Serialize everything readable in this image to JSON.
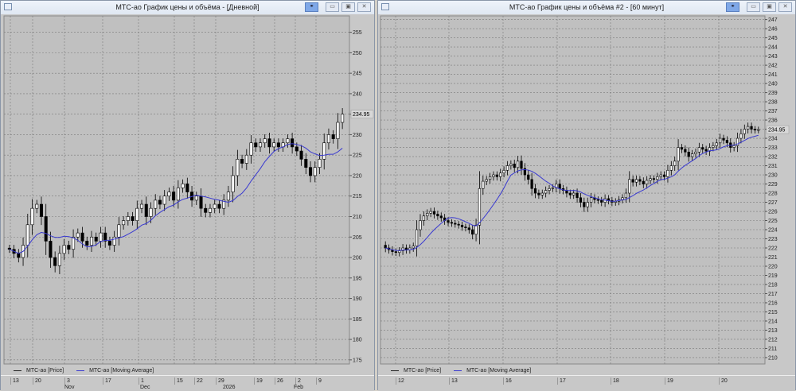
{
  "windows": [
    {
      "id": "left",
      "title": "МТС-ао График цены и объёма - [Дневной]",
      "legend": [
        "МТС-ао [Price]",
        "МТС-ао [Moving Average]"
      ],
      "last_price": "234.95",
      "y_ticks": [
        255,
        250,
        245,
        240,
        235,
        230,
        225,
        220,
        215,
        210,
        205,
        200,
        195,
        190,
        185,
        180,
        175
      ],
      "y_range": [
        174,
        259
      ],
      "date_ticks": [
        "13",
        "20",
        "3",
        "17",
        "1",
        "15",
        "22",
        "29",
        "19",
        "26",
        "2",
        "9"
      ],
      "month_labels": [
        "Nov",
        "Dec",
        "2026",
        "Feb"
      ],
      "closes": [
        202,
        201,
        200,
        203,
        208,
        212,
        213,
        210,
        204,
        200,
        198,
        201,
        203,
        202,
        205,
        206,
        204,
        203,
        205,
        204,
        206,
        204,
        203,
        205,
        208,
        209,
        210,
        209,
        212,
        213,
        210,
        212,
        214,
        213,
        215,
        216,
        214,
        217,
        218,
        216,
        214,
        215,
        212,
        211,
        212,
        213,
        212,
        214,
        216,
        220,
        224,
        223,
        225,
        228,
        227,
        228,
        229,
        227,
        228,
        227,
        228,
        229,
        227,
        226,
        224,
        222,
        220,
        222,
        224,
        228,
        230,
        229,
        233,
        235
      ]
    },
    {
      "id": "right",
      "title": "МТС-ао График цены и объёма #2 - [60 минут]",
      "legend": [
        "МТС-ао [Price]",
        "МТС-ао [Moving Average]"
      ],
      "last_price": "234.95",
      "y_ticks": [
        247,
        246,
        245,
        244,
        243,
        242,
        241,
        240,
        239,
        238,
        237,
        236,
        235,
        234,
        233,
        232,
        231,
        230,
        229,
        228,
        227,
        226,
        225,
        224,
        223,
        222,
        221,
        220,
        219,
        218,
        217,
        216,
        215,
        214,
        213,
        212,
        211,
        210
      ],
      "y_range": [
        209.3,
        247.4
      ],
      "date_ticks": [
        "12",
        "13",
        "16",
        "17",
        "18",
        "19",
        "20"
      ],
      "month_labels": [],
      "closes": [
        222,
        221.8,
        221.6,
        221.5,
        221.7,
        222,
        221.8,
        222,
        222.2,
        224,
        225,
        225.5,
        225.8,
        226,
        225.7,
        225.5,
        225.3,
        225,
        224.8,
        224.7,
        224.6,
        224.5,
        224.3,
        224.2,
        224,
        223.5,
        224.5,
        228.5,
        229.3,
        229.5,
        229.8,
        230,
        229.8,
        230.2,
        230.5,
        231,
        231.2,
        230.8,
        231.5,
        230.7,
        230,
        229.5,
        228.5,
        228,
        227.8,
        228,
        228.3,
        228.5,
        228.6,
        229,
        228.5,
        228.3,
        228,
        227.8,
        228,
        227.5,
        227,
        226.5,
        227,
        227.5,
        227.3,
        227.2,
        227,
        227.4,
        227.2,
        227,
        227.1,
        227.3,
        227.5,
        228,
        229.5,
        229.2,
        229.5,
        229.3,
        229,
        229.4,
        229.6,
        229.5,
        229.8,
        230,
        229.8,
        230.5,
        231,
        231.5,
        233,
        232.8,
        232.5,
        232,
        232.3,
        232.5,
        233,
        232.8,
        232.6,
        233,
        233.2,
        233.5,
        234,
        233.8,
        233.5,
        233,
        233.2,
        234,
        234.5,
        235,
        235.3,
        235,
        234.9,
        234.95
      ]
    }
  ],
  "colors": {
    "ma": "#3a3ad0",
    "bg": "#c0c0c0"
  }
}
